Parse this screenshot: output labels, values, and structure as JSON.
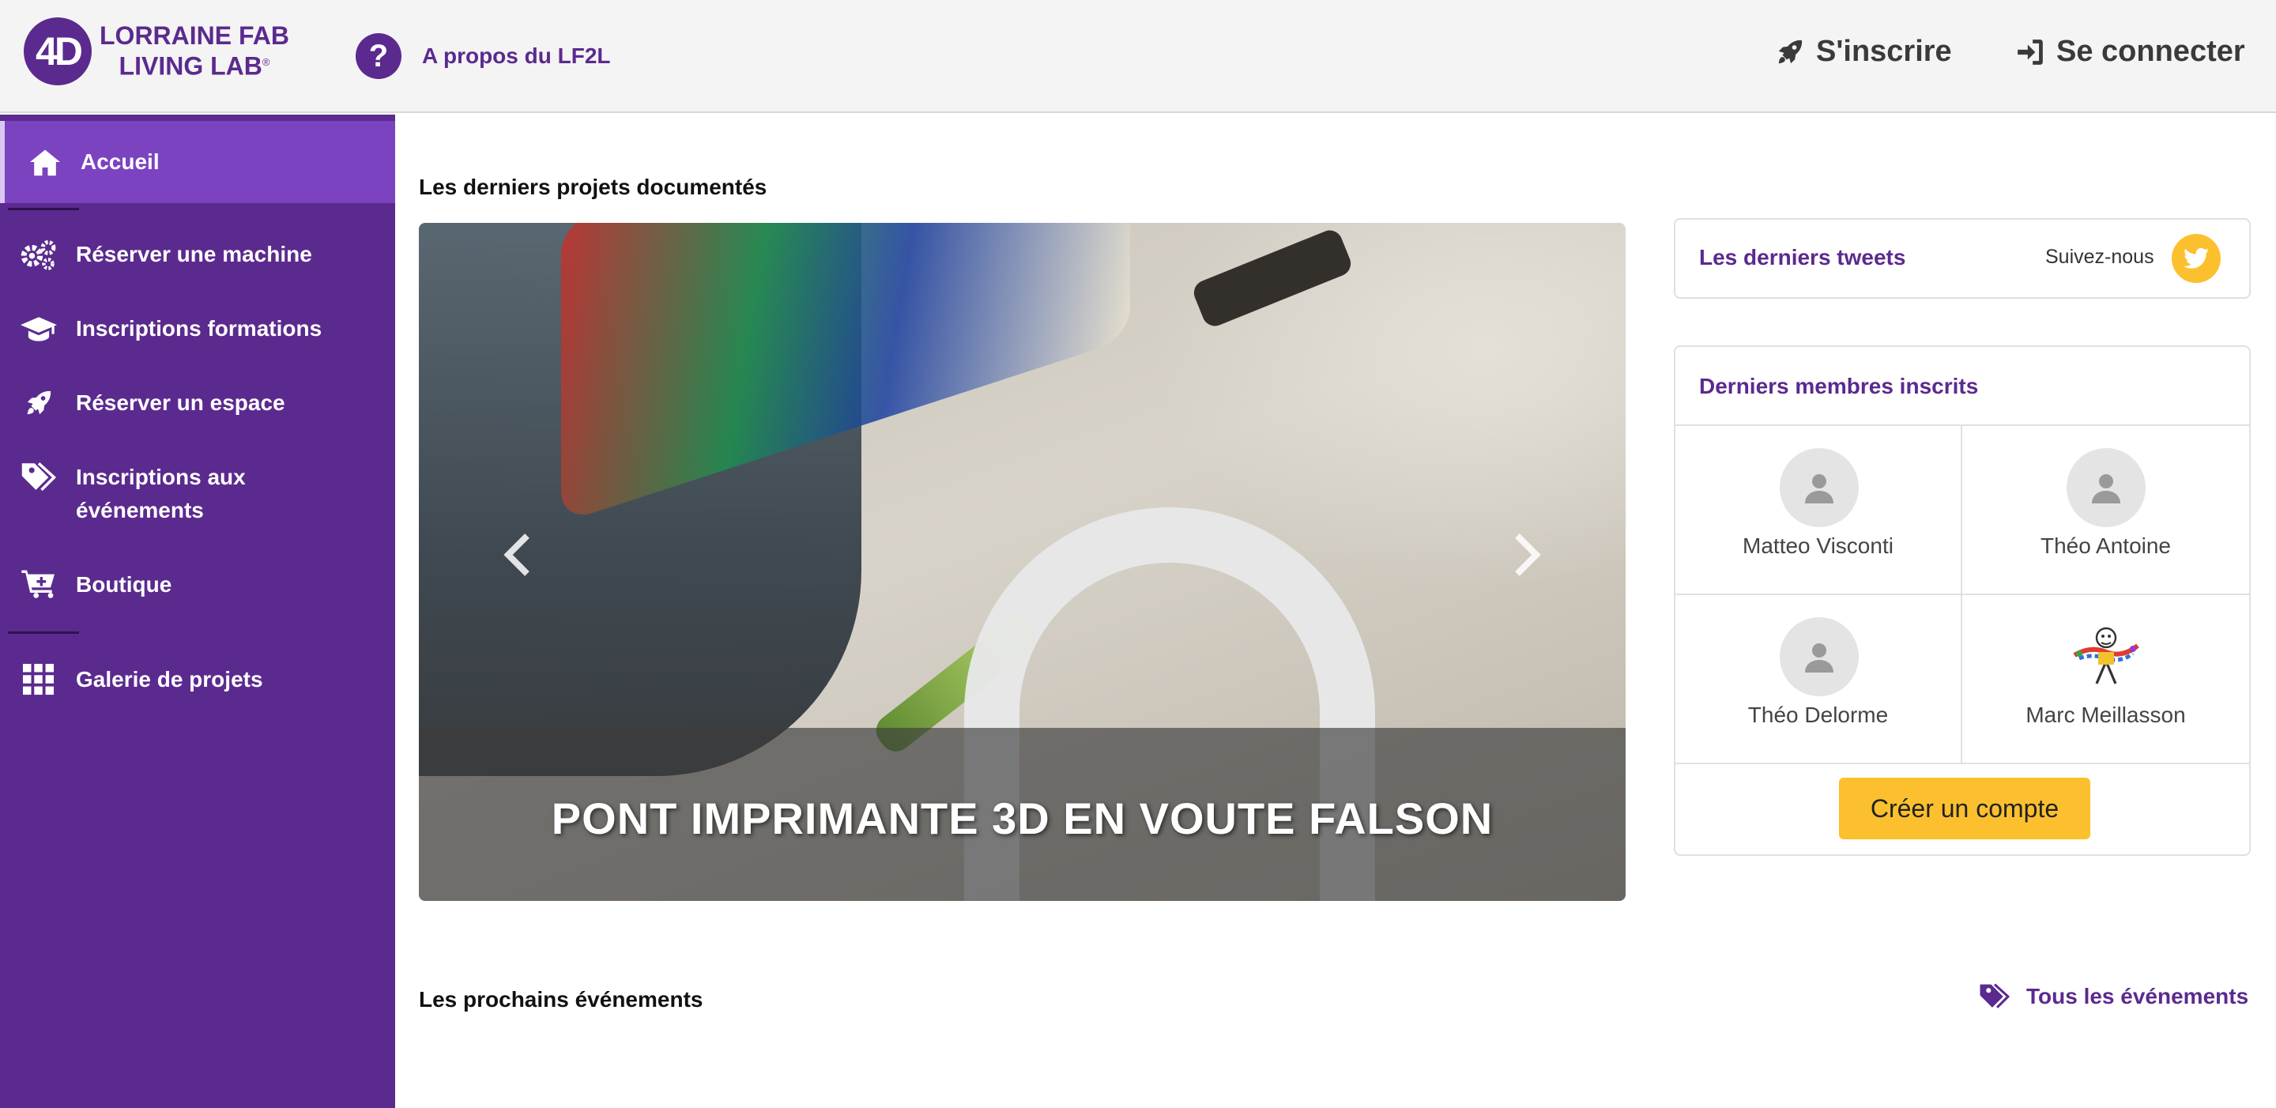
{
  "header": {
    "logo_mark": "4D",
    "logo_line1": "LORRAINE FAB",
    "logo_line2": "LIVING LAB",
    "logo_reg": "®",
    "about_icon": "?",
    "about_label": "A propos du LF2L",
    "signup_label": "S'inscrire",
    "signup_icon": "rocket-icon",
    "login_label": "Se connecter",
    "login_icon": "sign-in-icon"
  },
  "sidebar": {
    "items": [
      {
        "label": "Accueil",
        "icon": "home-icon",
        "active": true
      },
      {
        "label": "Réserver une machine",
        "icon": "cogs-icon"
      },
      {
        "label": "Inscriptions formations",
        "icon": "graduation-cap-icon"
      },
      {
        "label": "Réserver un espace",
        "icon": "rocket-icon"
      },
      {
        "label": "Inscriptions aux",
        "label2": "événements",
        "icon": "tags-icon"
      },
      {
        "label": "Boutique",
        "icon": "cart-plus-icon"
      },
      {
        "label": "Galerie de projets",
        "icon": "th-icon"
      }
    ]
  },
  "main": {
    "projects_title": "Les derniers projets documentés",
    "carousel": {
      "caption": "PONT IMPRIMANTE 3D EN VOUTE FALSON",
      "prev_icon": "chevron-left-icon",
      "next_icon": "chevron-right-icon"
    },
    "events_title": "Les prochains événements",
    "events_link": "Tous les événements"
  },
  "tweets": {
    "title": "Les derniers tweets",
    "follow_label": "Suivez-nous"
  },
  "members": {
    "title": "Derniers membres inscrits",
    "list": [
      {
        "name": "Matteo Visconti",
        "avatar": "default"
      },
      {
        "name": "Théo Antoine",
        "avatar": "default"
      },
      {
        "name": "Théo Delorme",
        "avatar": "default"
      },
      {
        "name": "Marc Meillasson",
        "avatar": "custom"
      }
    ],
    "create_account": "Créer un compte"
  },
  "colors": {
    "brand_purple": "#5b2a8e",
    "active_purple": "#7b43c0",
    "accent_yellow": "#fcc02e"
  }
}
